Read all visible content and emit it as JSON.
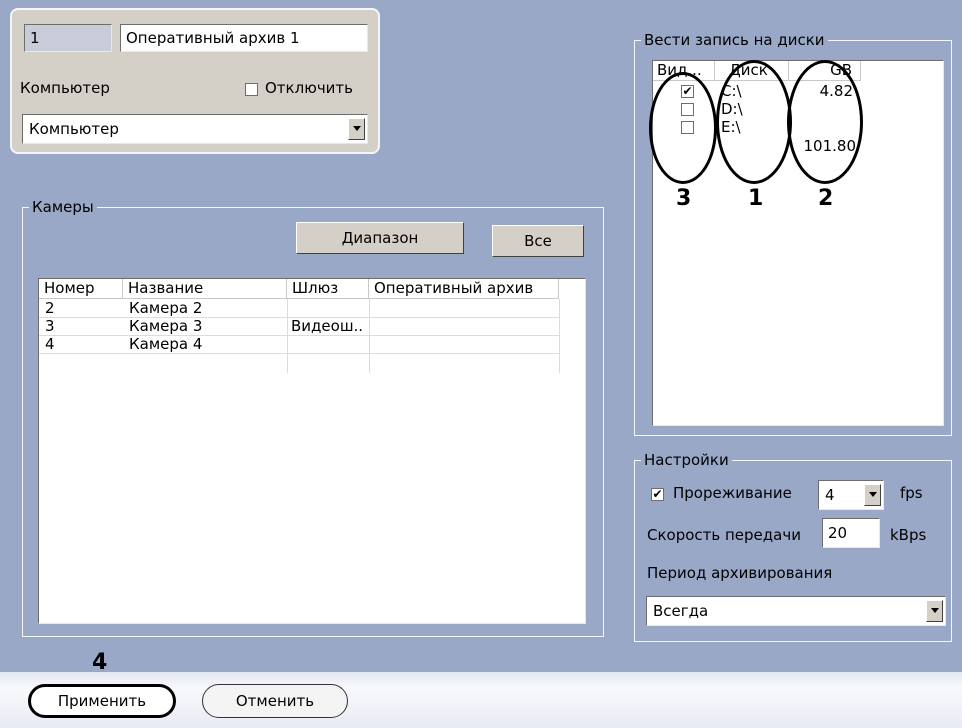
{
  "archive": {
    "number": "1",
    "name": "Оперативный архив 1",
    "computer_label": "Компьютер",
    "disable_label": "Отключить",
    "computer_value": "Компьютер"
  },
  "cameras": {
    "legend": "Камеры",
    "range_button": "Диапазон",
    "all_button": "Все",
    "columns": [
      "Номер",
      "Название",
      "Шлюз",
      "Оперативный архив"
    ],
    "rows": [
      {
        "num": "2",
        "name": "Камера 2",
        "gateway": "",
        "archive": ""
      },
      {
        "num": "3",
        "name": "Камера 3",
        "gateway": "Видеош..",
        "archive": ""
      },
      {
        "num": "4",
        "name": "Камера 4",
        "gateway": "",
        "archive": ""
      }
    ]
  },
  "disks": {
    "legend": "Вести запись на диски",
    "columns": [
      "Вид...",
      "Диск",
      "GB"
    ],
    "rows": [
      {
        "checked": true,
        "disk": "C:\\",
        "gb": "4.82"
      },
      {
        "checked": false,
        "disk": "D:\\",
        "gb": ""
      },
      {
        "checked": false,
        "disk": "E:\\",
        "gb": "101.80"
      }
    ],
    "callouts": [
      "3",
      "1",
      "2"
    ]
  },
  "settings": {
    "legend": "Настройки",
    "thinning_label": "Прореживание",
    "thinning_checked": true,
    "thinning_value": "4",
    "fps_unit": "fps",
    "rate_label": "Скорость передачи",
    "rate_value": "20",
    "rate_unit": "kBps",
    "period_label": "Период архивирования",
    "period_value": "Всегда"
  },
  "footer": {
    "apply_button": "Применить",
    "cancel_button": "Отменить",
    "callout": "4"
  }
}
